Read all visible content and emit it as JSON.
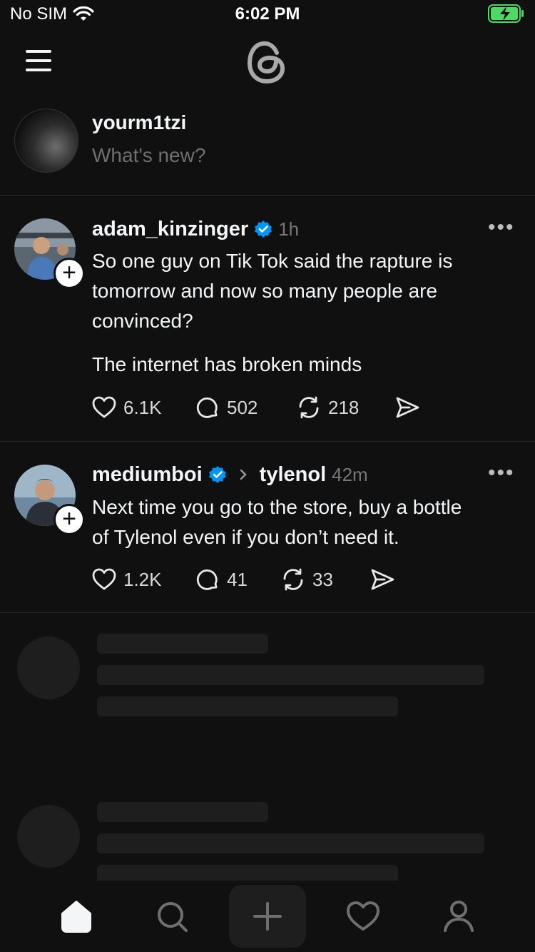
{
  "status_bar": {
    "carrier": "No SIM",
    "time": "6:02 PM"
  },
  "composer": {
    "username": "yourm1tzi",
    "placeholder": "What's new?"
  },
  "posts": [
    {
      "username": "adam_kinzinger",
      "verified": true,
      "time": "1h",
      "text_lines": [
        "So one guy on Tik Tok said the rapture is",
        "tomorrow and now so many people are",
        "convinced?"
      ],
      "text_second": "The internet has broken minds",
      "likes": "6.1K",
      "replies": "502",
      "reposts": "218"
    },
    {
      "username": "mediumboi",
      "verified": true,
      "reply_to": "tylenol",
      "time": "42m",
      "text_lines": [
        "Next time you go to the store, buy a bottle",
        "of Tylenol even if you don’t need it."
      ],
      "likes": "1.2K",
      "replies": "41",
      "reposts": "33"
    }
  ],
  "icons": {
    "menu": "menu-icon",
    "logo": "threads-logo",
    "verified": "verified-badge-icon",
    "like": "heart-icon",
    "reply": "comment-icon",
    "repost": "repost-icon",
    "share": "send-icon",
    "more": "more-icon",
    "tabs": [
      "home-icon",
      "search-icon",
      "plus-icon",
      "heart-icon",
      "profile-icon"
    ]
  },
  "colors": {
    "background": "#101010",
    "verified": "#0095f6",
    "battery": "#4cd964"
  }
}
